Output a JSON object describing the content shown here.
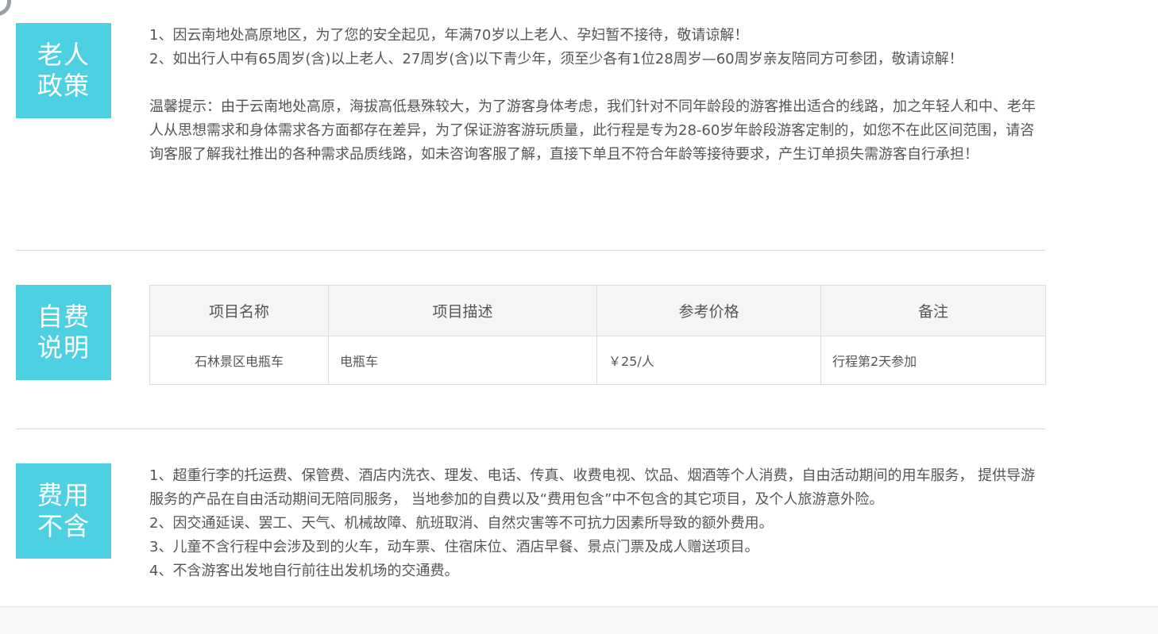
{
  "sections": {
    "elder_policy": {
      "badge": [
        "老人",
        "政策"
      ],
      "lines": [
        "1、因云南地处高原地区，为了您的安全起见，年满70岁以上老人、孕妇暂不接待，敬请谅解！",
        "2、如出行人中有65周岁(含)以上老人、27周岁(含)以下青少年，须至少各有1位28周岁—60周岁亲友陪同方可参团，敬请谅解！"
      ],
      "tip": "温馨提示：由于云南地处高原，海拔高低悬殊较大，为了游客身体考虑，我们针对不同年龄段的游客推出适合的线路，加之年轻人和中、老年人从思想需求和身体需求各方面都存在差异，为了保证游客游玩质量，此行程是专为28-60岁年龄段游客定制的，如您不在此区间范围，请咨询客服了解我社推出的各种需求品质线路，如未咨询客服了解，直接下单且不符合年龄等接待要求，产生订单损失需游客自行承担！"
    },
    "self_pay": {
      "badge": [
        "自费",
        "说明"
      ],
      "table": {
        "headers": [
          "项目名称",
          "项目描述",
          "参考价格",
          "备注"
        ],
        "rows": [
          [
            "石林景区电瓶车",
            "电瓶车",
            "￥25/人",
            "行程第2天参加"
          ]
        ]
      }
    },
    "fee_excluded": {
      "badge": [
        "费用",
        "不含"
      ],
      "lines": [
        "1、超重行李的托运费、保管费、酒店内洗衣、理发、电话、传真、收费电视、饮品、烟酒等个人消费，自由活动期间的用车服务， 提供导游服务的产品在自由活动期间无陪同服务， 当地参加的自费以及“费用包含”中不包含的其它项目，及个人旅游意外险。",
        "2、因交通延误、罢工、天气、机械故障、航班取消、自然灾害等不可抗力因素所导致的额外费用。",
        "3、儿童不含行程中会涉及到的火车，动车票、住宿床位、酒店早餐、景点门票及成人赠送项目。",
        "4、不含游客出发地自行前往出发机场的交通费。"
      ]
    }
  }
}
